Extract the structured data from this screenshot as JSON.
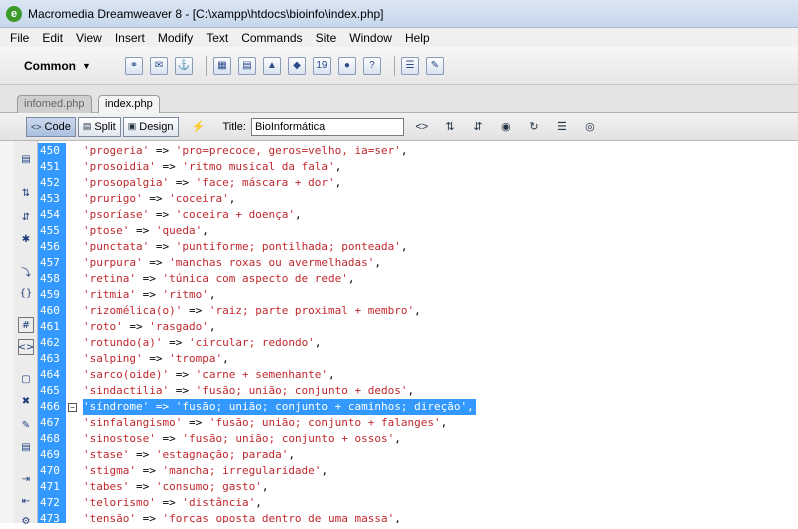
{
  "window": {
    "title": "Macromedia Dreamweaver 8 - [C:\\xampp\\htdocs\\bioinfo\\index.php]",
    "app_icon": "dreamweaver-icon"
  },
  "menu": [
    "File",
    "Edit",
    "View",
    "Insert",
    "Modify",
    "Text",
    "Commands",
    "Site",
    "Window",
    "Help"
  ],
  "insert_bar": {
    "category": "Common"
  },
  "tabs": [
    {
      "label": "infomed.php",
      "active": false
    },
    {
      "label": "index.php",
      "active": true
    }
  ],
  "doc_toolbar": {
    "code": "Code",
    "split": "Split",
    "design": "Design",
    "title_label": "Title:",
    "title_value": "BioInformática"
  },
  "code_lines": [
    {
      "n": "450",
      "k": "'progeria'",
      "v": "'pro=precoce, geros=velho, ia=ser'"
    },
    {
      "n": "451",
      "k": "'prosoidia'",
      "v": "'ritmo musical da fala'"
    },
    {
      "n": "452",
      "k": "'prosopalgia'",
      "v": "'face; máscara + dor'"
    },
    {
      "n": "453",
      "k": "'prurigo'",
      "v": "'coceira'"
    },
    {
      "n": "454",
      "k": "'psoríase'",
      "v": "'coceira + doença'"
    },
    {
      "n": "455",
      "k": "'ptose'",
      "v": "'queda'"
    },
    {
      "n": "456",
      "k": "'punctata'",
      "v": "'puntiforme; pontilhada; ponteada'"
    },
    {
      "n": "457",
      "k": "'purpura'",
      "v": "'manchas roxas ou avermelhadas'"
    },
    {
      "n": "458",
      "k": "'retina'",
      "v": "'túnica com aspecto de rede'"
    },
    {
      "n": "459",
      "k": "'ritmia'",
      "v": "'ritmo'"
    },
    {
      "n": "460",
      "k": "'rizomélica(o)'",
      "v": "'raiz; parte proximal + membro'"
    },
    {
      "n": "461",
      "k": "'roto'",
      "v": "'rasgado'"
    },
    {
      "n": "462",
      "k": "'rotundo(a)'",
      "v": "'circular; redondo'"
    },
    {
      "n": "463",
      "k": "'salping'",
      "v": "'trompa'"
    },
    {
      "n": "464",
      "k": "'sarco(oide)'",
      "v": "'carne + semenhante'"
    },
    {
      "n": "465",
      "k": "'sindactilia'",
      "v": "'fusão; união; conjunto + dedos'"
    },
    {
      "n": "466",
      "k": "'síndrome'",
      "v": "'fusão; união; conjunto + caminhos; direção'"
    },
    {
      "n": "467",
      "k": "'sinfalangismo'",
      "v": "'fusão; união; conjunto + falanges'"
    },
    {
      "n": "468",
      "k": "'sinostose'",
      "v": "'fusão; união; conjunto + ossos'"
    },
    {
      "n": "469",
      "k": "'stase'",
      "v": "'estagnação; parada'"
    },
    {
      "n": "470",
      "k": "'stigma'",
      "v": "'mancha; irregularidade'"
    },
    {
      "n": "471",
      "k": "'tabes'",
      "v": "'consumo; gasto'"
    },
    {
      "n": "472",
      "k": "'telorismo'",
      "v": "'distância'"
    },
    {
      "n": "473",
      "k": "'tensão'",
      "v": "'forças oposta dentro de uma massa'"
    }
  ],
  "arrow": "=>",
  "selected_line": "466",
  "colors": {
    "selection": "#3399ff",
    "string": "#c0282d"
  }
}
